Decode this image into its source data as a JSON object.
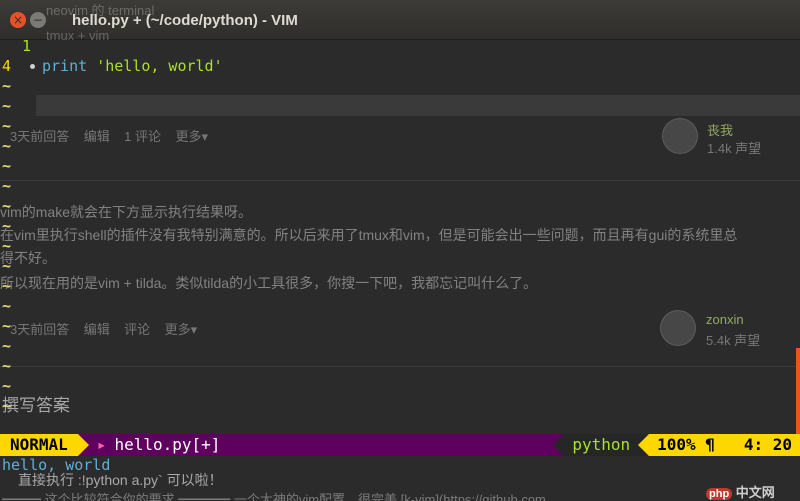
{
  "window": {
    "title": "hello.py + (~/code/python) - VIM",
    "close_glyph": "×",
    "min_glyph": "−",
    "behind_title": "neovim 的 terminal",
    "behind_line2": "tmux + vim"
  },
  "editor": {
    "relative_line": "1",
    "current_line": "4",
    "code_keyword": "print",
    "code_string": "'hello, world'",
    "tilde": "~"
  },
  "background_page": {
    "answer1_meta": [
      "3天前回答",
      "编辑",
      "1 评论",
      "更多▾"
    ],
    "answer1_author": "丧我",
    "answer1_rep": "1.4k 声望",
    "answer2_lines": [
      "vim的make就会在下方显示执行结果呀。",
      "在vim里执行shell的插件没有我特别满意的。所以后来用了tmux和vim，但是可能会出一些问题，而且再有gui的系统里总",
      "得不好。",
      "所以现在用的是vim + tilda。类似tilda的小工具很多，你搜一下吧，我都忘记叫什么了。"
    ],
    "answer2_meta": [
      "3天前回答",
      "编辑",
      "评论",
      "更多▾"
    ],
    "answer2_author": "zonxin",
    "answer2_rep": "5.4k 声望",
    "write_answer": "撰写答案"
  },
  "statusline": {
    "mode": "NORMAL",
    "modified_mark": "▸",
    "filename": "hello.py[+]",
    "filetype": "python",
    "position": "100% ¶   4: 20"
  },
  "cmdline": {
    "output": "hello, world",
    "behind_line1": "直接执行   :!python a.py`  可以啦！",
    "behind_line2": "━━━ 这个比较符合你的要求 ━━━━ 一个大神的vim配置，很完美 [k-vim](https://github.com",
    "watermark": "中文网",
    "watermark_badge": "php"
  },
  "colors": {
    "accent_yellow": "#ffd700",
    "status_purple": "#5f005f",
    "string_green": "#a6e22e",
    "keyword_blue": "#5fafd7",
    "ubuntu_orange": "#e95420"
  }
}
